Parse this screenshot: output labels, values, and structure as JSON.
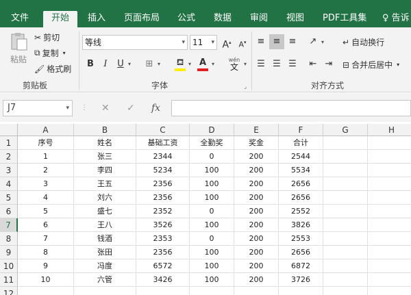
{
  "tabs": [
    {
      "label": "文件",
      "active": false
    },
    {
      "label": "开始",
      "active": true
    },
    {
      "label": "插入",
      "active": false
    },
    {
      "label": "页面布局",
      "active": false
    },
    {
      "label": "公式",
      "active": false
    },
    {
      "label": "数据",
      "active": false
    },
    {
      "label": "审阅",
      "active": false
    },
    {
      "label": "视图",
      "active": false
    },
    {
      "label": "PDF工具集",
      "active": false
    },
    {
      "label": "告诉",
      "active": false
    }
  ],
  "ribbon": {
    "clipboard": {
      "paste": "粘贴",
      "cut": "剪切",
      "copy": "复制",
      "format_painter": "格式刷",
      "group_label": "剪贴板"
    },
    "font": {
      "name": "等线",
      "size": "11",
      "bold": "B",
      "italic": "I",
      "underline": "U",
      "grow": "A",
      "shrink": "A",
      "phonetic_top": "wén",
      "phonetic_bottom": "文",
      "group_label": "字体"
    },
    "alignment": {
      "wrap_text": "自动换行",
      "merge_center": "合并后居中",
      "group_label": "对齐方式"
    }
  },
  "formula_bar": {
    "name_box": "J7",
    "fx": "fx",
    "formula": ""
  },
  "sheet": {
    "columns": [
      "A",
      "B",
      "C",
      "D",
      "E",
      "F",
      "G",
      "H"
    ],
    "row_numbers": [
      "1",
      "2",
      "3",
      "4",
      "5",
      "6",
      "7",
      "8",
      "9",
      "10",
      "11",
      "12"
    ],
    "selected_row": "7",
    "rows": [
      [
        "序号",
        "姓名",
        "基础工资",
        "全勤奖",
        "奖金",
        "合计"
      ],
      [
        "1",
        "张三",
        "2344",
        "0",
        "200",
        "2544"
      ],
      [
        "2",
        "李四",
        "5234",
        "100",
        "200",
        "5534"
      ],
      [
        "3",
        "王五",
        "2356",
        "100",
        "200",
        "2656"
      ],
      [
        "4",
        "刘六",
        "2356",
        "100",
        "200",
        "2656"
      ],
      [
        "5",
        "盛七",
        "2352",
        "0",
        "200",
        "2552"
      ],
      [
        "6",
        "王八",
        "3526",
        "100",
        "200",
        "3826"
      ],
      [
        "7",
        "钱酒",
        "2353",
        "0",
        "200",
        "2553"
      ],
      [
        "8",
        "张田",
        "2356",
        "100",
        "200",
        "2656"
      ],
      [
        "9",
        "冯度",
        "6572",
        "100",
        "200",
        "6872"
      ],
      [
        "10",
        "六管",
        "3426",
        "100",
        "200",
        "3726"
      ]
    ]
  },
  "colors": {
    "accent": "#217346",
    "font_color_bar": "#e02020",
    "highlight_bar": "#ffee00"
  }
}
